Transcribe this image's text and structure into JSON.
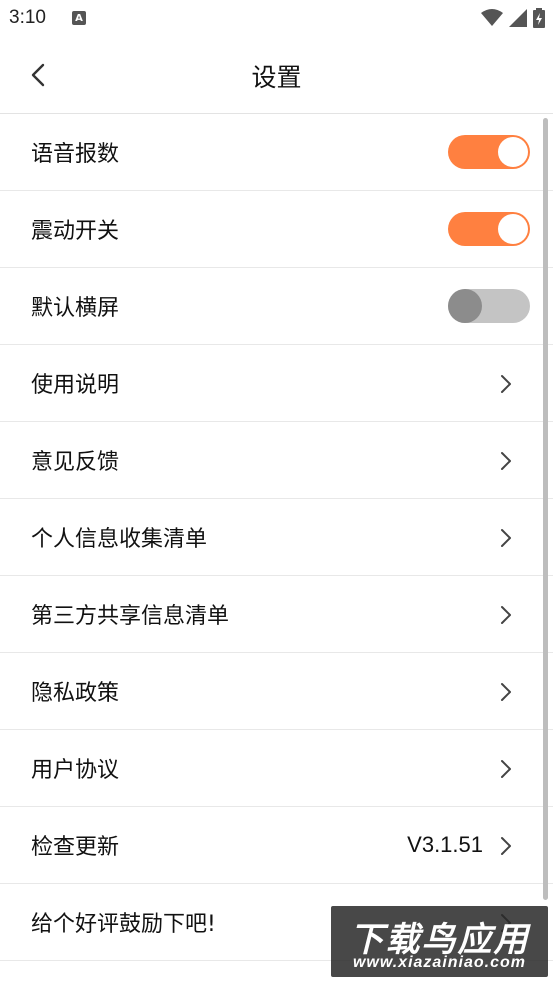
{
  "status_bar": {
    "time": "3:10",
    "notification_icon": "a-icon",
    "wifi_icon": "wifi-icon",
    "signal_icon": "signal-icon",
    "battery_icon": "battery-charging-icon"
  },
  "header": {
    "title": "设置",
    "back_icon": "chevron-left-icon"
  },
  "settings": [
    {
      "label": "语音报数",
      "type": "toggle",
      "enabled": true
    },
    {
      "label": "震动开关",
      "type": "toggle",
      "enabled": true
    },
    {
      "label": "默认横屏",
      "type": "toggle",
      "enabled": false
    },
    {
      "label": "使用说明",
      "type": "link"
    },
    {
      "label": "意见反馈",
      "type": "link"
    },
    {
      "label": "个人信息收集清单",
      "type": "link"
    },
    {
      "label": "第三方共享信息清单",
      "type": "link"
    },
    {
      "label": "隐私政策",
      "type": "link"
    },
    {
      "label": "用户协议",
      "type": "link"
    },
    {
      "label": "检查更新",
      "type": "link",
      "value": "V3.1.51"
    },
    {
      "label": "给个好评鼓励下吧!",
      "type": "link"
    }
  ],
  "watermark": {
    "title": "下载鸟应用",
    "url": "www.xiazainiao.com"
  },
  "colors": {
    "toggle_on": "#ff8040",
    "toggle_off": "#c4c4c4",
    "divider": "#e8e8e8"
  }
}
